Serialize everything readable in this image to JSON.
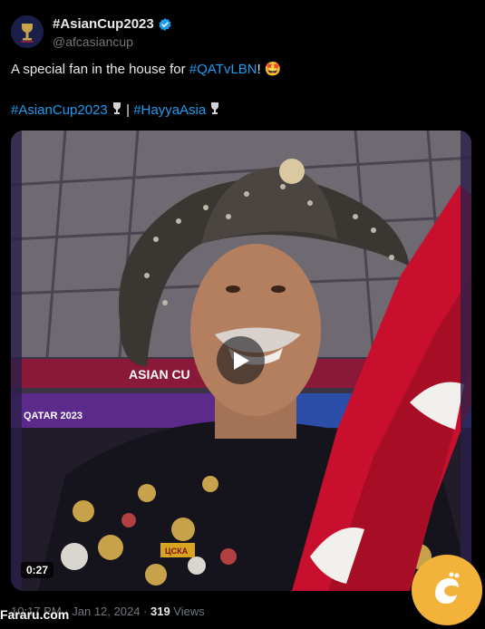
{
  "author": {
    "display_name": "#AsianCup2023",
    "handle": "@afcasiancup",
    "verified_icon": "verified-badge-icon"
  },
  "tweet": {
    "line1_prefix": "A special fan in the house for ",
    "line1_hashtag": "#QATvLBN",
    "line1_suffix": "!",
    "emoji": "🤩",
    "line2_hashtag1": "#AsianCup2023",
    "separator": "|",
    "line2_hashtag2": "#HayyaAsia"
  },
  "media": {
    "duration": "0:27",
    "banner_text_1": "ASIAN CU",
    "banner_text_2": "QATAR 2023",
    "pin_text": "ЦСКА"
  },
  "meta": {
    "time": "10:17 PM",
    "dot": "·",
    "date": "Jan 12, 2024",
    "views_count": "319",
    "views_label": "Views"
  },
  "watermark": {
    "text": "Fararu.com"
  },
  "colors": {
    "background": "#000000",
    "link": "#1d9bf0",
    "muted": "#71767b",
    "verified": "#1d9bf0",
    "scarf_red": "#c8102e",
    "badge_orange": "#f3b23a"
  }
}
